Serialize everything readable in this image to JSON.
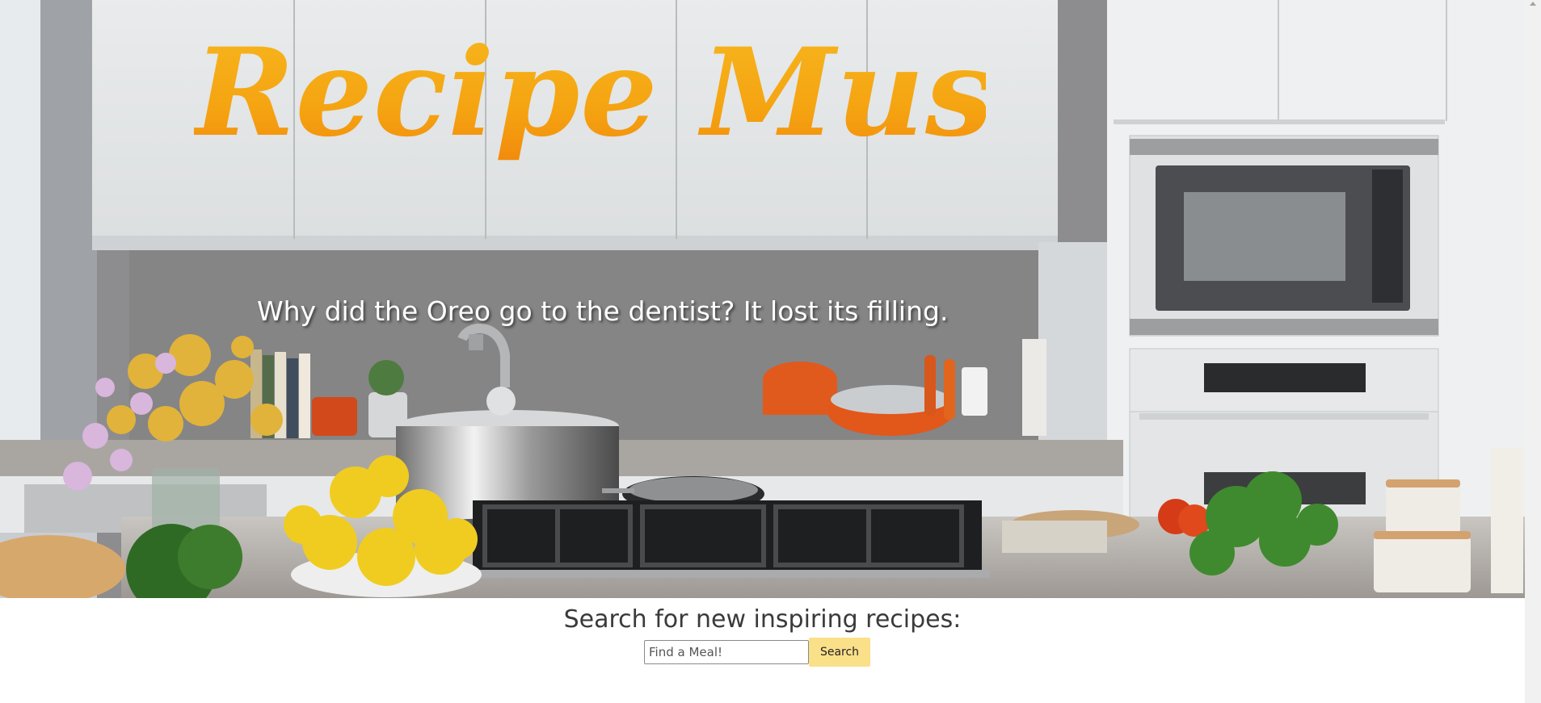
{
  "hero": {
    "title": "Recipe Muse",
    "joke": "Why did the Oreo go to the dentist? It lost its filling."
  },
  "search": {
    "heading": "Search for new inspiring recipes:",
    "placeholder": "Find a Meal!",
    "button_label": "Search"
  },
  "colors": {
    "title_gradient_top": "#f6b81f",
    "title_gradient_bottom": "#f2870c",
    "search_button": "#fbe08a"
  },
  "icons": {
    "scroll_up": "triangle-up"
  }
}
